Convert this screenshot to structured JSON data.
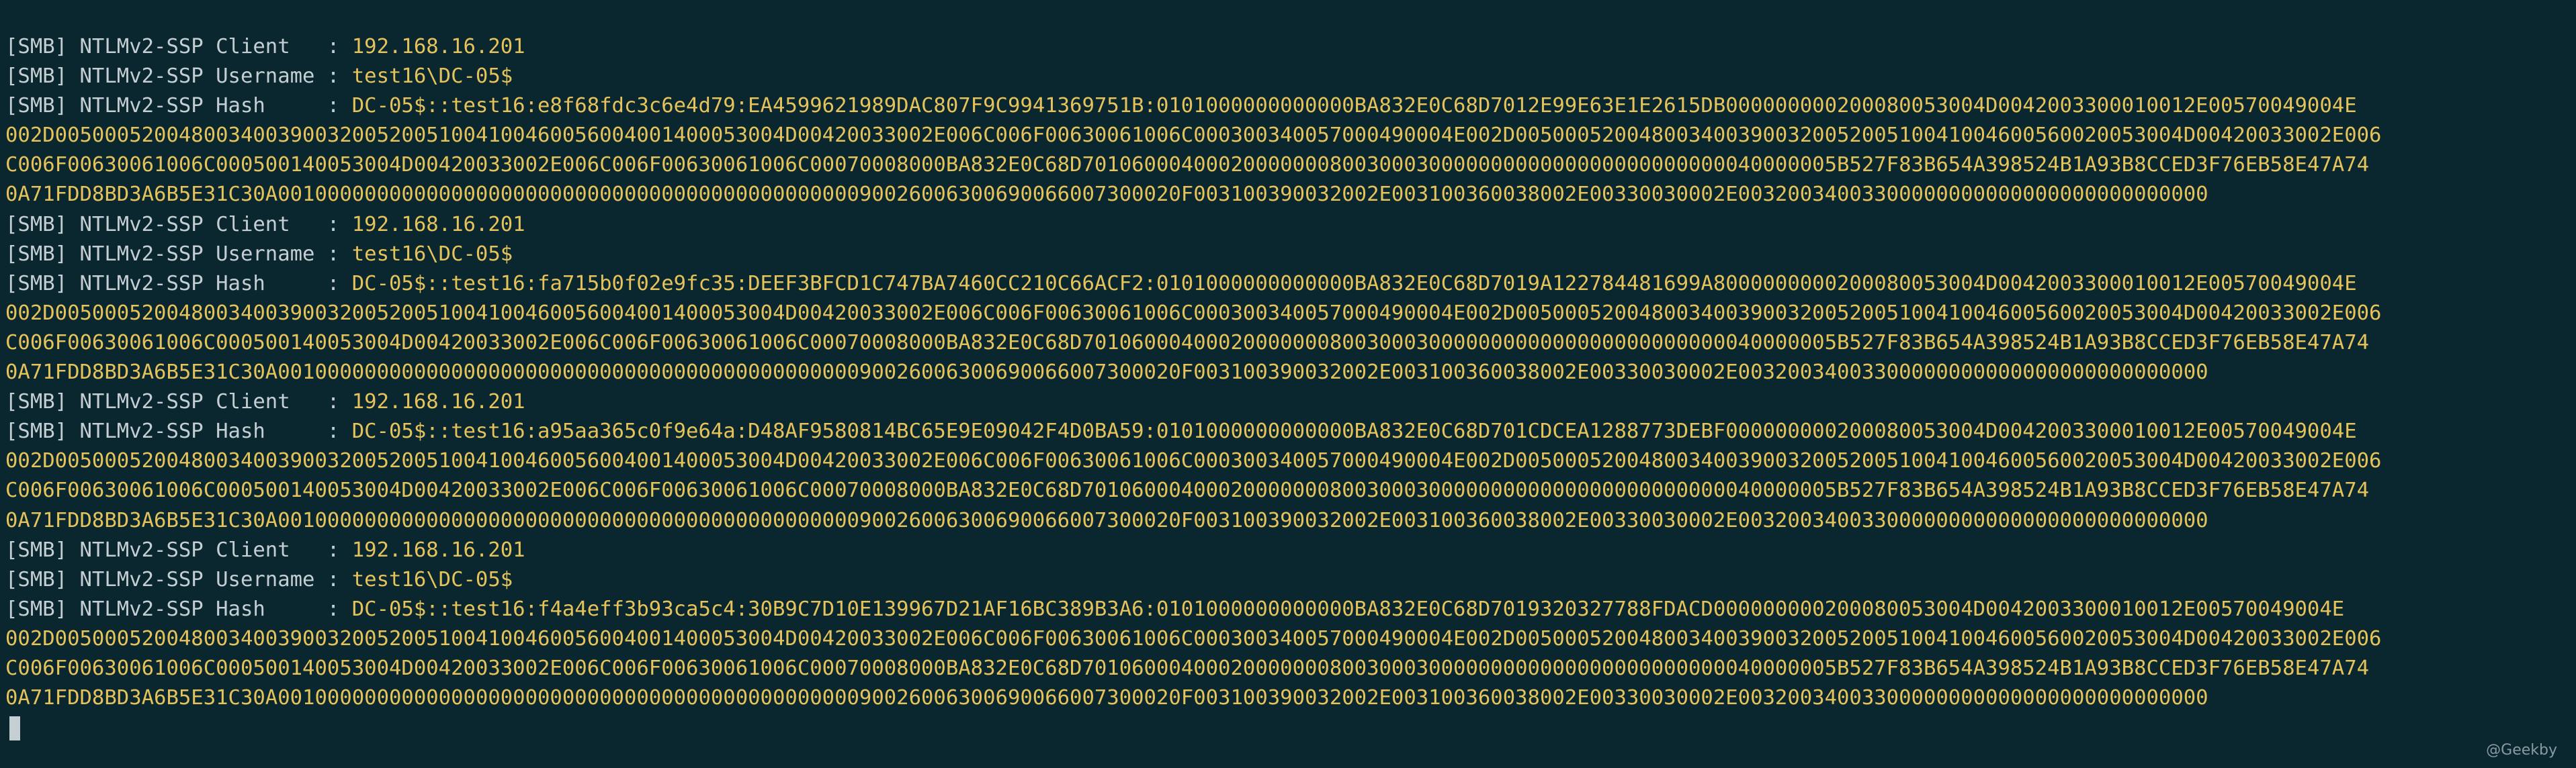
{
  "terminal": {
    "colors": {
      "background": "#0a2730",
      "text": "#c5ced2",
      "value": "#e5c35a"
    },
    "lines": [
      {
        "prefix": "[SMB] NTLMv2-SSP Client   : ",
        "value": "192.168.16.201"
      },
      {
        "prefix": "[SMB] NTLMv2-SSP Username : ",
        "value": "test16\\DC-05$"
      },
      {
        "prefix": "[SMB] NTLMv2-SSP Hash     : ",
        "value": "DC-05$::test16:e8f68fdc3c6e4d79:EA4599621989DAC807F9C9941369751B:0101000000000000BA832E0C68D7012E99E63E1E2615DB000000000200080053004D0042003300010012E00570049004E"
      },
      {
        "prefix": "",
        "value": "002D00500052004800340039003200520051004100460056004001400053004D00420033002E006C006F00630061006C000300340057000490004E002D005000520048003400390032005200510041004600560020053004D00420033002E006"
      },
      {
        "prefix": "",
        "value": "C006F00630061006C000500140053004D00420033002E006C006F00630061006C00070008000BA832E0C68D7010600040002000000080030003000000000000000000000000040000005B527F83B654A398524B1A93B8CCED3F76EB58E47A74"
      },
      {
        "prefix": "",
        "value": "0A71FDD8BD3A6B5E31C30A0010000000000000000000000000000000000000000000090026006300690066007300020F003100390032002E003100360038002E00330030002E00320034003300000000000000000000000000"
      },
      {
        "prefix": "[SMB] NTLMv2-SSP Client   : ",
        "value": "192.168.16.201"
      },
      {
        "prefix": "[SMB] NTLMv2-SSP Username : ",
        "value": "test16\\DC-05$"
      },
      {
        "prefix": "[SMB] NTLMv2-SSP Hash     : ",
        "value": "DC-05$::test16:fa715b0f02e9fc35:DEEF3BFCD1C747BA7460CC210C66ACF2:0101000000000000BA832E0C68D7019A122784481699A8000000000200080053004D0042003300010012E00570049004E"
      },
      {
        "prefix": "",
        "value": "002D00500052004800340039003200520051004100460056004001400053004D00420033002E006C006F00630061006C000300340057000490004E002D005000520048003400390032005200510041004600560020053004D00420033002E006"
      },
      {
        "prefix": "",
        "value": "C006F00630061006C000500140053004D00420033002E006C006F00630061006C00070008000BA832E0C68D7010600040002000000080030003000000000000000000000000040000005B527F83B654A398524B1A93B8CCED3F76EB58E47A74"
      },
      {
        "prefix": "",
        "value": "0A71FDD8BD3A6B5E31C30A0010000000000000000000000000000000000000000000090026006300690066007300020F003100390032002E003100360038002E00330030002E00320034003300000000000000000000000000"
      },
      {
        "prefix": "[SMB] NTLMv2-SSP Client   : ",
        "value": "192.168.16.201"
      },
      {
        "prefix": "[SMB] NTLMv2-SSP Hash     : ",
        "value": "DC-05$::test16:a95aa365c0f9e64a:D48AF9580814BC65E9E09042F4D0BA59:0101000000000000BA832E0C68D701CDCEA1288773DEBF000000000200080053004D0042003300010012E00570049004E"
      },
      {
        "prefix": "",
        "value": "002D00500052004800340039003200520051004100460056004001400053004D00420033002E006C006F00630061006C000300340057000490004E002D005000520048003400390032005200510041004600560020053004D00420033002E006"
      },
      {
        "prefix": "",
        "value": "C006F00630061006C000500140053004D00420033002E006C006F00630061006C00070008000BA832E0C68D7010600040002000000080030003000000000000000000000000040000005B527F83B654A398524B1A93B8CCED3F76EB58E47A74"
      },
      {
        "prefix": "",
        "value": "0A71FDD8BD3A6B5E31C30A0010000000000000000000000000000000000000000000090026006300690066007300020F003100390032002E003100360038002E00330030002E00320034003300000000000000000000000000"
      },
      {
        "prefix": "[SMB] NTLMv2-SSP Client   : ",
        "value": "192.168.16.201"
      },
      {
        "prefix": "[SMB] NTLMv2-SSP Username : ",
        "value": "test16\\DC-05$"
      },
      {
        "prefix": "[SMB] NTLMv2-SSP Hash     : ",
        "value": "DC-05$::test16:f4a4eff3b93ca5c4:30B9C7D10E139967D21AF16BC389B3A6:0101000000000000BA832E0C68D7019320327788FDACD000000000200080053004D0042003300010012E00570049004E"
      },
      {
        "prefix": "",
        "value": "002D00500052004800340039003200520051004100460056004001400053004D00420033002E006C006F00630061006C000300340057000490004E002D005000520048003400390032005200510041004600560020053004D00420033002E006"
      },
      {
        "prefix": "",
        "value": "C006F00630061006C000500140053004D00420033002E006C006F00630061006C00070008000BA832E0C68D7010600040002000000080030003000000000000000000000000040000005B527F83B654A398524B1A93B8CCED3F76EB58E47A74"
      },
      {
        "prefix": "",
        "value": "0A71FDD8BD3A6B5E31C30A0010000000000000000000000000000000000000000000090026006300690066007300020F003100390032002E003100360038002E00330030002E00320034003300000000000000000000000000"
      }
    ]
  },
  "watermark": "@Geekby"
}
